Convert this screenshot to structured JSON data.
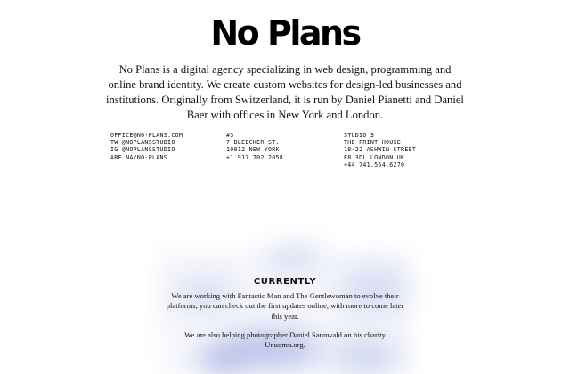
{
  "header": {
    "logo": "No Plans"
  },
  "intro": {
    "text": "No Plans is a digital agency specializing in web design, programming and online brand identity. We create custom websites for design-led businesses and institutions. Originally from Switzerland, it is run by Daniel Pianetti and Daniel Baer with offices in New York and London."
  },
  "contact": {
    "online": [
      "OFFICE@NO-PLANS.COM",
      "TW @NOPLANSSTUDIO",
      "IG @NOPLANSSTUDIO",
      "ARE.NA/NO-PLANS"
    ],
    "new_york": [
      "#3",
      "7 BLEECKER ST.",
      "10012 NEW YORK",
      "+1 917.702.2058"
    ],
    "london": [
      "STUDIO 3",
      "THE PRINT HOUSE",
      "18-22 ASHWIN STREET",
      "E8 3DL LONDON UK",
      "+44 741.554.6270"
    ]
  },
  "currently": {
    "title": "CURRENTLY",
    "paragraphs": [
      "We are working with Fantastic Man and The Gentlewoman to evolve their platforms, you can check out the first updates online, with more to come later this year.",
      "We are also helping photographer Daniel Sannwald on his charity Unuomu.org."
    ]
  }
}
